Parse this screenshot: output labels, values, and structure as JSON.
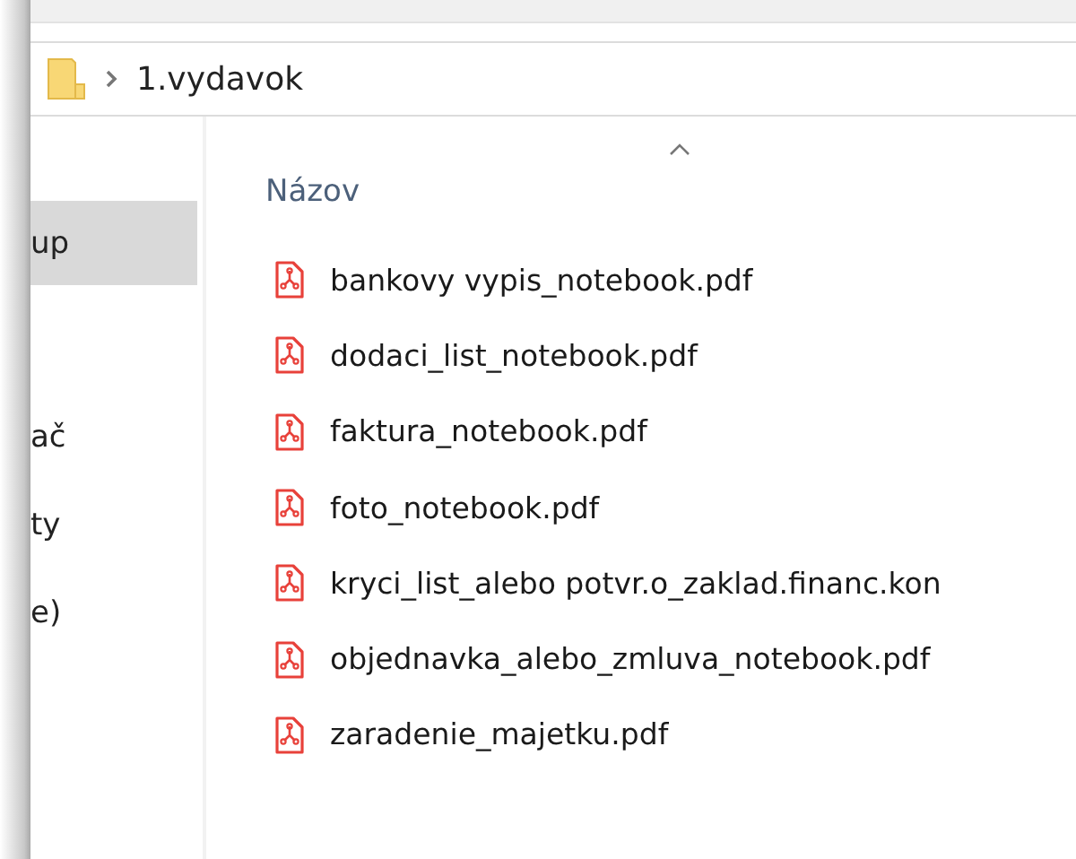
{
  "address_bar": {
    "path": "1.vydavok"
  },
  "sidebar": {
    "items": [
      {
        "label": "up",
        "selected": true
      },
      {
        "label": "ač",
        "selected": false
      },
      {
        "label": "ty",
        "selected": false
      },
      {
        "label": "e)",
        "selected": false
      }
    ]
  },
  "file_list": {
    "columns": [
      {
        "label": "Názov",
        "sorted": true
      }
    ],
    "files": [
      {
        "name": "bankovy vypis_notebook.pdf"
      },
      {
        "name": "dodaci_list_notebook.pdf"
      },
      {
        "name": "faktura_notebook.pdf"
      },
      {
        "name": "foto_notebook.pdf"
      },
      {
        "name": "kryci_list_alebo potvr.o_zaklad.financ.kon"
      },
      {
        "name": "objednavka_alebo_zmluva_notebook.pdf"
      },
      {
        "name": "zaradenie_majetku.pdf"
      }
    ]
  }
}
